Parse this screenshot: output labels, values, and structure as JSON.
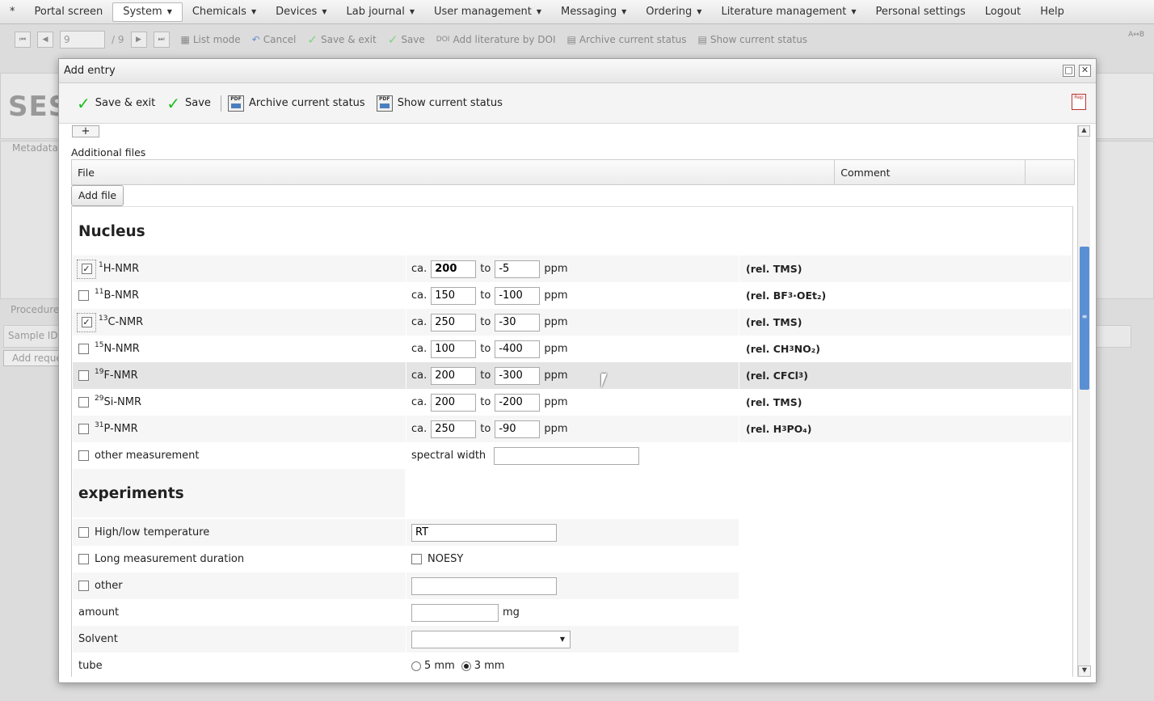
{
  "menu": {
    "items": [
      "*",
      "Portal screen",
      "System",
      "Chemicals",
      "Devices",
      "Lab journal",
      "User management",
      "Messaging",
      "Ordering",
      "Literature management",
      "Personal settings",
      "Logout",
      "Help"
    ],
    "active": "System"
  },
  "bg_toolbar": {
    "page": "9",
    "total": "/ 9",
    "list_mode": "List mode",
    "cancel": "Cancel",
    "save_exit": "Save & exit",
    "save": "Save",
    "doi_prefix": "DOI",
    "add_doi": "Add literature by DOI",
    "archive": "Archive current status",
    "show": "Show current status",
    "corner": "A↔B"
  },
  "background": {
    "title": "SES",
    "metadata": "Metadata",
    "procedure": "Procedure",
    "sample_id": "Sample ID",
    "add_request": "Add reque"
  },
  "dialog": {
    "title": "Add entry",
    "maximize_glyph": "□",
    "close_glyph": "✕",
    "toolbar": {
      "save_exit": "Save & exit",
      "save": "Save",
      "archive": "Archive current status",
      "show": "Show current status",
      "pdf_text": "PDF",
      "report_text": "Rep"
    },
    "plus": "+",
    "additional_files": "Additional files",
    "files_table": {
      "file": "File",
      "comment": "Comment"
    },
    "add_file": "Add file",
    "nucleus_heading": "Nucleus",
    "labels": {
      "ca": "ca.",
      "to": "to",
      "ppm": "ppm"
    },
    "nuclei": [
      {
        "mass": "1",
        "name": "H-NMR",
        "checked": true,
        "from": "200",
        "to": "-5",
        "ref_pre": "(rel. TMS)",
        "ref_sub": "",
        "ref_post": ""
      },
      {
        "mass": "11",
        "name": "B-NMR",
        "checked": false,
        "from": "150",
        "to": "-100",
        "ref_pre": "(rel. BF",
        "ref_sub": "3",
        "ref_post": "·OEt₂)"
      },
      {
        "mass": "13",
        "name": "C-NMR",
        "checked": true,
        "from": "250",
        "to": "-30",
        "ref_pre": "(rel. TMS)",
        "ref_sub": "",
        "ref_post": ""
      },
      {
        "mass": "15",
        "name": "N-NMR",
        "checked": false,
        "from": "100",
        "to": "-400",
        "ref_pre": "(rel. CH",
        "ref_sub": "3",
        "ref_post": "NO₂)"
      },
      {
        "mass": "19",
        "name": "F-NMR",
        "checked": false,
        "from": "200",
        "to": "-300",
        "ref_pre": "(rel. CFCl",
        "ref_sub": "3",
        "ref_post": ")"
      },
      {
        "mass": "29",
        "name": "Si-NMR",
        "checked": false,
        "from": "200",
        "to": "-200",
        "ref_pre": "(rel. TMS)",
        "ref_sub": "",
        "ref_post": ""
      },
      {
        "mass": "31",
        "name": "P-NMR",
        "checked": false,
        "from": "250",
        "to": "-90",
        "ref_pre": "(rel. H",
        "ref_sub": "3",
        "ref_post": "PO₄)"
      }
    ],
    "other_measurement": "other measurement",
    "spectral_width": "spectral width",
    "spectral_width_value": "",
    "experiments_heading": "experiments",
    "high_low_temp": "High/low temperature",
    "temp_value": "RT",
    "long_duration": "Long measurement duration",
    "noesy": "NOESY",
    "other": "other",
    "other_value": "",
    "amount": "amount",
    "amount_value": "",
    "amount_unit": "mg",
    "solvent": "Solvent",
    "solvent_value": "",
    "tube": "tube",
    "tube_5": "5 mm",
    "tube_3": "3 mm",
    "tube_selected": "3 mm"
  }
}
